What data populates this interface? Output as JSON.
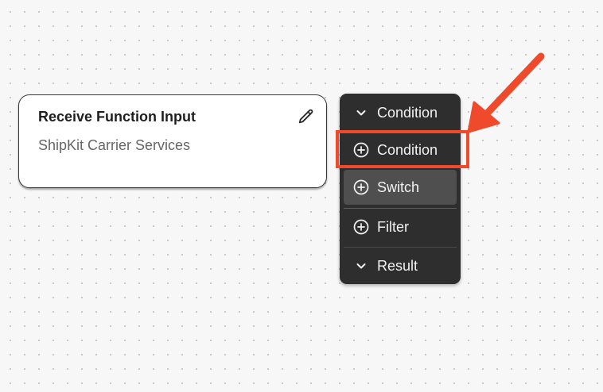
{
  "node": {
    "title": "Receive Function Input",
    "subtitle": "ShipKit Carrier Services",
    "edit_icon": "pencil-icon"
  },
  "menu": {
    "items": [
      {
        "label": "Condition",
        "icon": "chevron-down-icon",
        "state": "group-header"
      },
      {
        "label": "Condition",
        "icon": "plus-circle-icon",
        "state": "highlighted"
      },
      {
        "label": "Switch",
        "icon": "plus-circle-icon",
        "state": "hovered"
      },
      {
        "label": "Filter",
        "icon": "plus-circle-icon",
        "state": "normal"
      },
      {
        "label": "Result",
        "icon": "chevron-down-icon",
        "state": "group-header"
      }
    ]
  },
  "annotation": {
    "color": "#ef4a2c",
    "target": "Condition"
  },
  "colors": {
    "canvas_background": "#f7f7f7",
    "menu_background": "#2e2e2e",
    "menu_hover": "#4f4f4f",
    "annotation": "#ef4a2c"
  }
}
